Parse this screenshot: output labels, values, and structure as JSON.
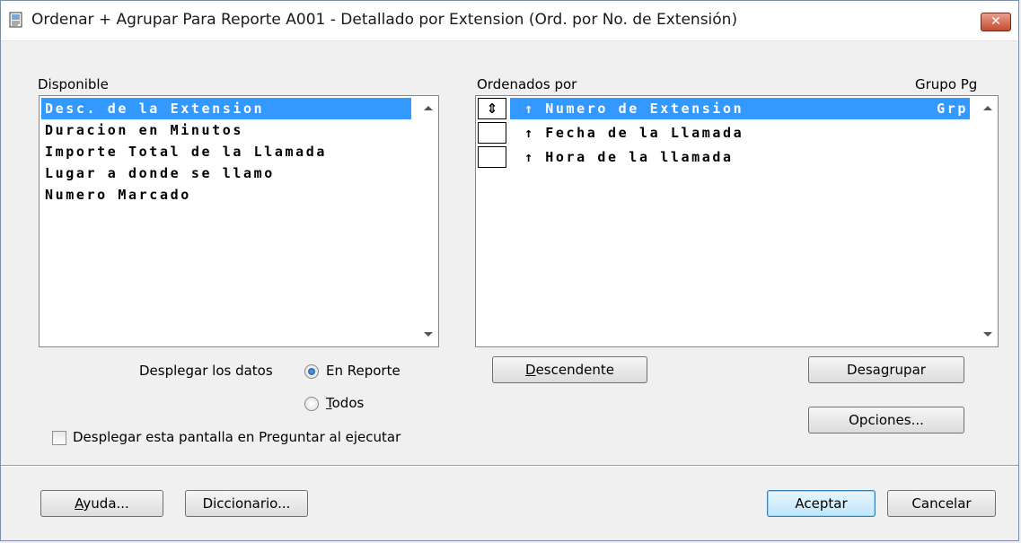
{
  "window": {
    "title": "Ordenar + Agrupar Para Reporte A001 - Detallado por Extension (Ord. por No. de Extensión)",
    "close_label": "✕"
  },
  "available": {
    "label": "Disponible",
    "items": [
      "Desc. de la Extension",
      "Duracion en Minutos",
      "Importe Total de la Llamada",
      "Lugar a donde se llamo",
      "Numero Marcado"
    ],
    "selected_index": 0
  },
  "sorted": {
    "label": "Ordenados por",
    "group_label": "Grupo Pg",
    "items": [
      {
        "label": "↑ Numero de Extension",
        "group": "Grp",
        "box": "⇕"
      },
      {
        "label": "↑ Fecha de la Llamada",
        "group": "",
        "box": ""
      },
      {
        "label": "↑ Hora de la llamada",
        "group": "",
        "box": ""
      }
    ],
    "selected_index": 0
  },
  "display": {
    "label": "Desplegar los datos",
    "option_report": "En Reporte",
    "option_all_prefix": "",
    "option_all_underlined": "T",
    "option_all_rest": "odos",
    "selected": "En Reporte"
  },
  "checkbox": {
    "label": "Desplegar esta pantalla en Preguntar al ejecutar",
    "checked": false
  },
  "buttons": {
    "descending": {
      "u": "D",
      "rest": "escendente"
    },
    "ungroup": {
      "pre": "Desa",
      "u": "g",
      "rest": "rupar"
    },
    "options": "Opciones...",
    "help": {
      "u": "A",
      "rest": "yuda..."
    },
    "dictionary": "Diccionario...",
    "accept": "Aceptar",
    "cancel": "Cancelar"
  }
}
